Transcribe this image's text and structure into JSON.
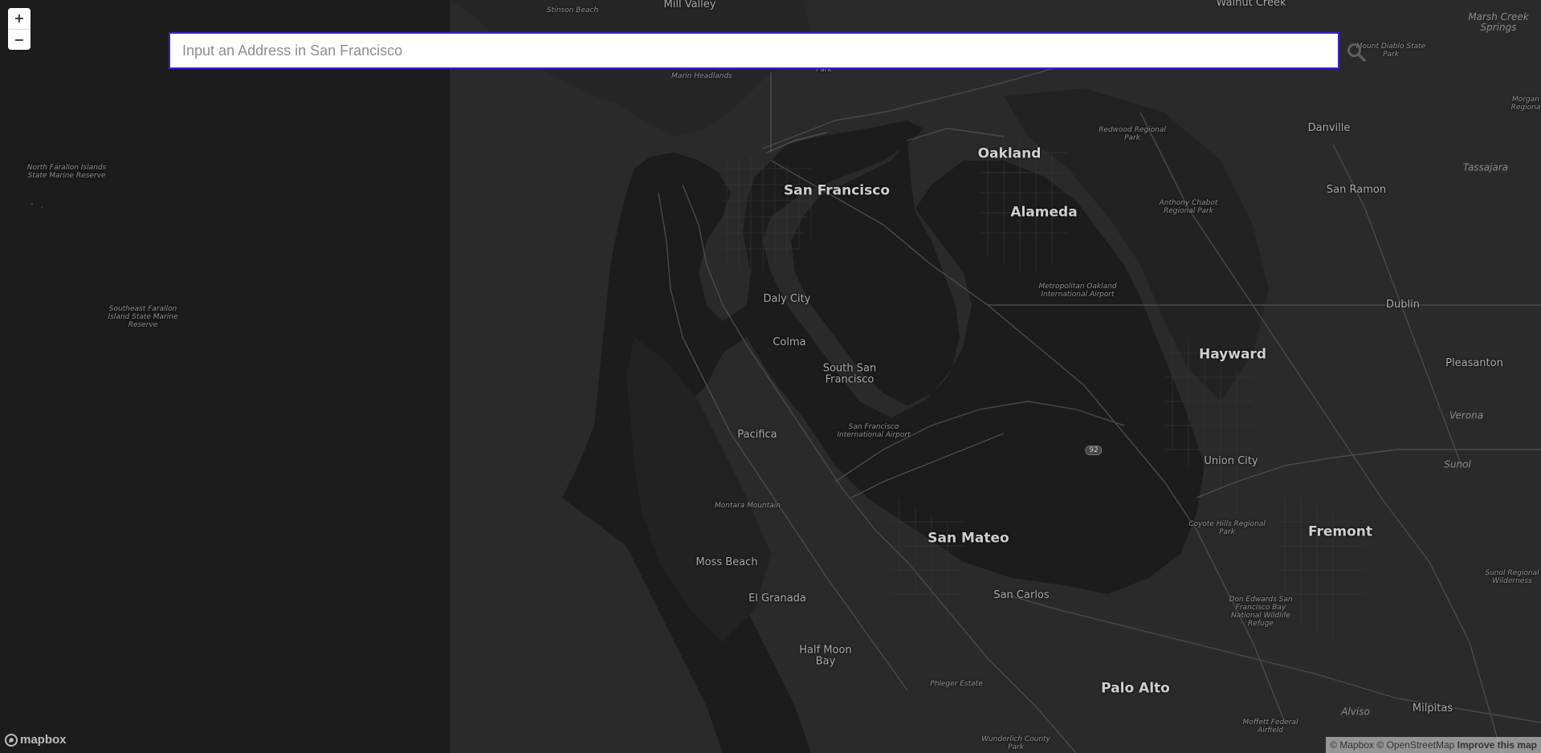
{
  "zoom": {
    "in_label": "+",
    "out_label": "−"
  },
  "search": {
    "placeholder": "Input an Address in San Francisco",
    "value": ""
  },
  "labels": {
    "stinson_beach": "Stinson Beach",
    "mill_valley": "Mill Valley",
    "walnut_creek": "Walnut Creek",
    "marsh_creek_springs": "Marsh Creek Springs",
    "marin_headlands": "Marin Headlands",
    "park_fragment": "Park",
    "mount_diablo": "Mount Diablo State Park",
    "morgan_region": "Morgan Regiona",
    "redwood_regional": "Redwood Regional Park",
    "danville": "Danville",
    "tassajara": "Tassajara",
    "oakland": "Oakland",
    "san_francisco": "San Francisco",
    "alameda": "Alameda",
    "anthony_chabot": "Anthony Chabot Regional Park",
    "san_ramon": "San Ramon",
    "north_farallon": "North Farallon Islands State Marine Reserve",
    "southeast_farallon": "Southeast Farallon Island State Marine Reserve",
    "daly_city": "Daly City",
    "metro_oakland_airport": "Metropolitan Oakland International Airport",
    "dublin": "Dublin",
    "colma": "Colma",
    "hayward": "Hayward",
    "pleasanton": "Pleasanton",
    "south_sf": "South San Francisco",
    "sf_airport": "San Francisco International Airport",
    "verona": "Verona",
    "pacifica": "Pacifica",
    "union_city": "Union City",
    "sunol": "Sunol",
    "montara_mountain": "Montara Mountain",
    "coyote_hills": "Coyote Hills Regional Park",
    "fremont": "Fremont",
    "san_mateo": "San Mateo",
    "moss_beach": "Moss Beach",
    "sunol_wilderness": "Sunol Regional Wilderness",
    "el_granada": "El Granada",
    "san_carlos": "San Carlos",
    "don_edwards": "Don Edwards San Francisco Bay National Wildlife Refuge",
    "half_moon_bay": "Half Moon Bay",
    "phleger_estate": "Phleger Estate",
    "palo_alto": "Palo Alto",
    "alviso": "Alviso",
    "milpitas": "Milpitas",
    "moffett_airfield": "Moffett Federal Airfield",
    "wunderlich_park": "Wunderlich County Park"
  },
  "route_shield": "92",
  "branding": {
    "logo_text": "mapbox"
  },
  "attribution": {
    "mapbox": "© Mapbox",
    "osm": "© OpenStreetMap",
    "improve": "Improve this map"
  },
  "colors": {
    "water": "#1c1c1c",
    "land": "#2a2a2a",
    "land_dark": "#202020",
    "road": "#4a4a4a",
    "accent_focus": "#3b1fd6"
  }
}
